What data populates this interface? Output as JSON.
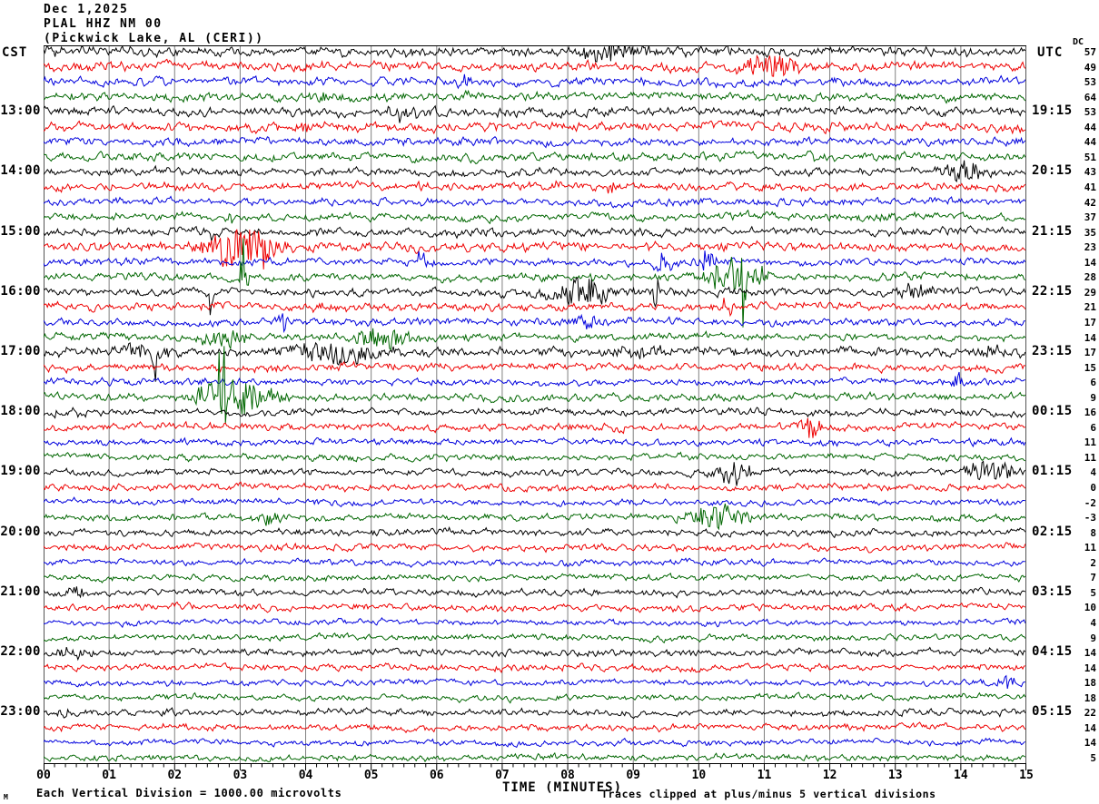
{
  "title": {
    "date": "Dec 1,2025",
    "station": "PLAL HHZ NM 00",
    "location": "(Pickwick Lake, AL (CERI))"
  },
  "axes": {
    "left_timezone_label": "CST",
    "right_timezone_label": "UTC",
    "dc_column_label": "DC",
    "x_axis_title": "TIME (MINUTES)",
    "x_tick_labels": [
      "00",
      "01",
      "02",
      "03",
      "04",
      "05",
      "06",
      "07",
      "08",
      "09",
      "10",
      "11",
      "12",
      "13",
      "14",
      "15"
    ],
    "x_minor_ticks_per_minute": 6,
    "x_range_minutes": [
      0,
      15
    ]
  },
  "footer": {
    "corner_mark": "M",
    "scale_note": "Each Vertical Division = 1000.00 microvolts",
    "clip_note": "Traces clipped at plus/minus 5 vertical divisions"
  },
  "colors": {
    "background": "#ffffff",
    "grid": "#808080",
    "border": "#000000",
    "trace_cycle": [
      "#000000",
      "#ee0000",
      "#0000dd",
      "#006600"
    ]
  },
  "chart_data": {
    "type": "line",
    "subtype": "helicorder-seismogram",
    "title": "PLAL HHZ NM 00 (Pickwick Lake, AL (CERI)) Dec 1,2025",
    "xlabel": "TIME (MINUTES)",
    "x_range": [
      0,
      15
    ],
    "minutes_per_row": 15,
    "grid": true,
    "rows": [
      {
        "color": "black",
        "dc": 57,
        "noise": 3.0,
        "events": [
          {
            "m": 8.75,
            "w": 0.45,
            "a": 8
          },
          {
            "m": 0.3,
            "w": 0.15,
            "a": 4
          }
        ]
      },
      {
        "color": "red",
        "dc": 49,
        "noise": 3.0,
        "events": [
          {
            "m": 11.05,
            "w": 0.3,
            "a": 13
          }
        ]
      },
      {
        "color": "blue",
        "dc": 53,
        "noise": 2.8,
        "events": [
          {
            "m": 6.45,
            "w": 0.15,
            "a": 6
          }
        ]
      },
      {
        "color": "green",
        "dc": 64,
        "noise": 2.8,
        "events": [
          {
            "m": 4.2,
            "w": 0.1,
            "a": 5
          },
          {
            "m": 6.5,
            "w": 0.12,
            "a": 7
          }
        ]
      },
      {
        "cst": "13:00",
        "utc": "19:15",
        "color": "black",
        "dc": 53,
        "noise": 2.8,
        "events": [
          {
            "m": 5.5,
            "w": 0.3,
            "a": 6
          }
        ]
      },
      {
        "color": "red",
        "dc": 44,
        "noise": 3.0,
        "events": [
          {
            "m": 4.0,
            "w": 0.06,
            "a": 9
          }
        ]
      },
      {
        "color": "blue",
        "dc": 44,
        "noise": 2.6,
        "events": []
      },
      {
        "color": "green",
        "dc": 51,
        "noise": 2.6,
        "events": [
          {
            "m": 11.7,
            "w": 0.08,
            "a": 7
          }
        ]
      },
      {
        "cst": "14:00",
        "utc": "20:15",
        "color": "black",
        "dc": 43,
        "noise": 2.6,
        "events": [
          {
            "m": 14.05,
            "w": 0.25,
            "a": 10
          }
        ]
      },
      {
        "color": "red",
        "dc": 41,
        "noise": 2.6,
        "events": [
          {
            "m": 7.8,
            "w": 0.07,
            "a": 7
          },
          {
            "m": 8.65,
            "w": 0.07,
            "a": 7
          }
        ]
      },
      {
        "color": "blue",
        "dc": 42,
        "noise": 2.4,
        "events": []
      },
      {
        "color": "green",
        "dc": 37,
        "noise": 2.4,
        "events": [
          {
            "m": 2.9,
            "w": 0.12,
            "a": 5
          },
          {
            "m": 12.9,
            "w": 0.1,
            "a": 5
          }
        ]
      },
      {
        "cst": "15:00",
        "utc": "21:15",
        "color": "black",
        "dc": 35,
        "noise": 2.6,
        "events": [
          {
            "m": 2.6,
            "w": 0.05,
            "a": 11,
            "d": -1
          },
          {
            "m": 10.85,
            "w": 0.05,
            "a": 7
          }
        ]
      },
      {
        "color": "red",
        "dc": 23,
        "noise": 3.0,
        "events": [
          {
            "m": 2.9,
            "w": 0.3,
            "a": 24
          },
          {
            "m": 3.35,
            "w": 0.2,
            "a": 18
          }
        ]
      },
      {
        "color": "blue",
        "dc": 14,
        "noise": 2.4,
        "events": [
          {
            "m": 5.75,
            "w": 0.05,
            "a": 15
          },
          {
            "m": 9.45,
            "w": 0.12,
            "a": 12
          },
          {
            "m": 10.1,
            "w": 0.12,
            "a": 13
          }
        ]
      },
      {
        "color": "green",
        "dc": 28,
        "noise": 2.4,
        "events": [
          {
            "m": 3.05,
            "w": 0.04,
            "a": 48
          },
          {
            "m": 10.55,
            "w": 0.3,
            "a": 18
          },
          {
            "m": 10.68,
            "w": 0.04,
            "a": 70
          }
        ]
      },
      {
        "cst": "16:00",
        "utc": "22:15",
        "color": "black",
        "dc": 29,
        "noise": 2.6,
        "events": [
          {
            "m": 2.55,
            "w": 0.04,
            "a": 26,
            "d": -1
          },
          {
            "m": 8.2,
            "w": 0.3,
            "a": 16
          },
          {
            "m": 9.35,
            "w": 0.05,
            "a": 18
          },
          {
            "m": 13.3,
            "w": 0.2,
            "a": 6
          }
        ]
      },
      {
        "color": "red",
        "dc": 21,
        "noise": 2.6,
        "events": [
          {
            "m": 4.3,
            "w": 0.15,
            "a": 5
          },
          {
            "m": 10.45,
            "w": 0.06,
            "a": 16
          }
        ]
      },
      {
        "color": "blue",
        "dc": 17,
        "noise": 2.4,
        "events": [
          {
            "m": 3.65,
            "w": 0.05,
            "a": 12
          },
          {
            "m": 8.3,
            "w": 0.15,
            "a": 10
          }
        ]
      },
      {
        "color": "green",
        "dc": 14,
        "noise": 2.4,
        "events": [
          {
            "m": 2.7,
            "w": 0.25,
            "a": 10
          },
          {
            "m": 5.15,
            "w": 0.3,
            "a": 13
          }
        ]
      },
      {
        "cst": "17:00",
        "utc": "23:15",
        "color": "black",
        "dc": 17,
        "noise": 3.0,
        "events": [
          {
            "m": 1.7,
            "w": 0.05,
            "a": 30,
            "d": -1
          },
          {
            "m": 1.55,
            "w": 0.25,
            "a": 9
          },
          {
            "m": 4.5,
            "w": 0.45,
            "a": 13
          },
          {
            "m": 9.1,
            "w": 0.3,
            "a": 7
          },
          {
            "m": 14.5,
            "w": 0.2,
            "a": 6
          }
        ]
      },
      {
        "color": "red",
        "dc": 15,
        "noise": 2.6,
        "events": [
          {
            "m": 8.3,
            "w": 0.1,
            "a": 5
          }
        ]
      },
      {
        "color": "blue",
        "dc": 6,
        "noise": 2.2,
        "events": [
          {
            "m": 13.95,
            "w": 0.06,
            "a": 12
          }
        ]
      },
      {
        "color": "green",
        "dc": 9,
        "noise": 2.4,
        "events": [
          {
            "m": 2.8,
            "w": 0.3,
            "a": 24
          },
          {
            "m": 2.72,
            "w": 0.04,
            "a": 55
          },
          {
            "m": 3.4,
            "w": 0.25,
            "a": 9
          }
        ]
      },
      {
        "cst": "18:00",
        "utc": "00:15",
        "color": "black",
        "dc": 16,
        "noise": 2.4,
        "events": [
          {
            "m": 0.35,
            "w": 0.15,
            "a": 5
          }
        ]
      },
      {
        "color": "red",
        "dc": 6,
        "noise": 2.4,
        "events": [
          {
            "m": 11.7,
            "w": 0.12,
            "a": 11
          }
        ]
      },
      {
        "color": "blue",
        "dc": 11,
        "noise": 2.2,
        "events": []
      },
      {
        "color": "green",
        "dc": 11,
        "noise": 2.2,
        "events": []
      },
      {
        "cst": "19:00",
        "utc": "01:15",
        "color": "black",
        "dc": 4,
        "noise": 2.2,
        "events": [
          {
            "m": 10.55,
            "w": 0.2,
            "a": 15
          },
          {
            "m": 14.45,
            "w": 0.25,
            "a": 11
          }
        ]
      },
      {
        "color": "red",
        "dc": 0,
        "noise": 2.2,
        "events": []
      },
      {
        "color": "blue",
        "dc": -2,
        "noise": 2.0,
        "events": []
      },
      {
        "color": "green",
        "dc": -3,
        "noise": 2.2,
        "events": [
          {
            "m": 3.4,
            "w": 0.12,
            "a": 7
          },
          {
            "m": 10.3,
            "w": 0.3,
            "a": 14
          }
        ]
      },
      {
        "cst": "20:00",
        "utc": "02:15",
        "color": "black",
        "dc": 8,
        "noise": 2.2,
        "events": []
      },
      {
        "color": "red",
        "dc": 11,
        "noise": 2.2,
        "events": []
      },
      {
        "color": "blue",
        "dc": 2,
        "noise": 2.0,
        "events": []
      },
      {
        "color": "green",
        "dc": 7,
        "noise": 2.0,
        "events": []
      },
      {
        "cst": "21:00",
        "utc": "03:15",
        "color": "black",
        "dc": 5,
        "noise": 2.2,
        "events": [
          {
            "m": 0.55,
            "w": 0.15,
            "a": 5
          }
        ]
      },
      {
        "color": "red",
        "dc": 10,
        "noise": 2.2,
        "events": []
      },
      {
        "color": "blue",
        "dc": 4,
        "noise": 1.9,
        "events": []
      },
      {
        "color": "green",
        "dc": 9,
        "noise": 2.0,
        "events": []
      },
      {
        "cst": "22:00",
        "utc": "04:15",
        "color": "black",
        "dc": 14,
        "noise": 2.2,
        "events": [
          {
            "m": 0.45,
            "w": 0.2,
            "a": 6
          }
        ]
      },
      {
        "color": "red",
        "dc": 14,
        "noise": 2.2,
        "events": []
      },
      {
        "color": "blue",
        "dc": 18,
        "noise": 2.0,
        "events": [
          {
            "m": 14.75,
            "w": 0.12,
            "a": 8
          }
        ]
      },
      {
        "color": "green",
        "dc": 18,
        "noise": 2.0,
        "events": []
      },
      {
        "cst": "23:00",
        "utc": "05:15",
        "color": "black",
        "dc": 22,
        "noise": 2.2,
        "events": [
          {
            "m": 0.3,
            "w": 0.1,
            "a": 5
          }
        ]
      },
      {
        "color": "red",
        "dc": 14,
        "noise": 2.2,
        "events": []
      },
      {
        "color": "blue",
        "dc": 14,
        "noise": 1.9,
        "events": []
      },
      {
        "color": "green",
        "dc": 5,
        "noise": 2.0,
        "events": []
      }
    ]
  }
}
